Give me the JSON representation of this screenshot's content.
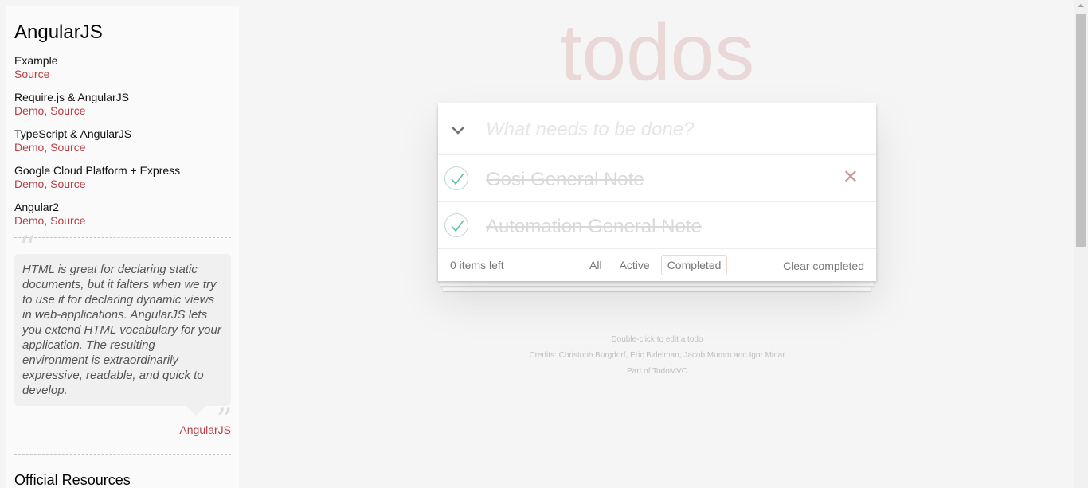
{
  "sidebar": {
    "title": "AngularJS",
    "items": [
      {
        "name": "Example",
        "demo": "",
        "sep": "",
        "source": "Source"
      },
      {
        "name": "Require.js & AngularJS",
        "demo": "Demo",
        "sep": ", ",
        "source": "Source"
      },
      {
        "name": "TypeScript & AngularJS",
        "demo": "Demo",
        "sep": ", ",
        "source": "Source"
      },
      {
        "name": "Google Cloud Platform + Express",
        "demo": "Demo",
        "sep": ", ",
        "source": "Source"
      },
      {
        "name": "Angular2",
        "demo": "Demo",
        "sep": ", ",
        "source": "Source"
      }
    ],
    "quote": "HTML is great for declaring static documents, but it falters when we try to use it for declaring dynamic views in web-applications. AngularJS lets you extend HTML vocabulary for your application. The resulting environment is extraordinarily expressive, readable, and quick to develop.",
    "quote_author": "AngularJS",
    "official_resources": "Official Resources"
  },
  "app": {
    "title": "todos",
    "new_todo_placeholder": "What needs to be done?",
    "todos": [
      {
        "label": "Gosi General Note",
        "completed": true
      },
      {
        "label": "Automation General Note",
        "completed": true
      }
    ],
    "footer": {
      "count": "0 items left",
      "filters": [
        "All",
        "Active",
        "Completed"
      ],
      "selected_filter": "Completed",
      "clear": "Clear completed"
    }
  },
  "info": {
    "line1": "Double-click to edit a todo",
    "line2": "Credits: Christoph Burgdorf, Eric Bidelman, Jacob Mumm and Igor Minar",
    "line3_prefix": "Part of ",
    "line3_link": "TodoMVC"
  },
  "colors": {
    "accent": "#b83f45",
    "title": "rgba(175,47,47,0.15)",
    "check": "#5dc2af"
  }
}
